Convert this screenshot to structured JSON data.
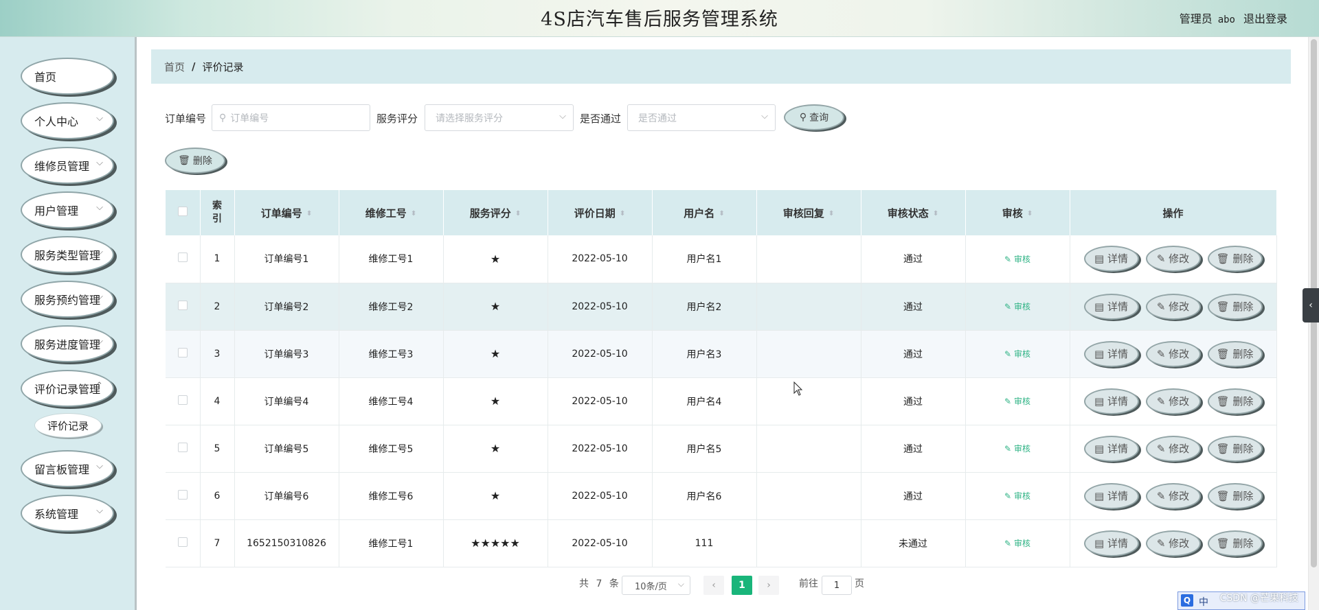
{
  "header": {
    "title": "4S店汽车售后服务管理系统",
    "user_role": "管理员",
    "user_name": "abo",
    "logout": "退出登录"
  },
  "sidebar": {
    "items": [
      {
        "label": "首页",
        "has_arrow": false
      },
      {
        "label": "个人中心",
        "has_arrow": true
      },
      {
        "label": "维修员管理",
        "has_arrow": true
      },
      {
        "label": "用户管理",
        "has_arrow": true
      },
      {
        "label": "服务类型管理",
        "has_arrow": true
      },
      {
        "label": "服务预约管理",
        "has_arrow": true
      },
      {
        "label": "服务进度管理",
        "has_arrow": true
      },
      {
        "label": "评价记录管理",
        "has_arrow": true
      },
      {
        "label": "留言板管理",
        "has_arrow": true
      },
      {
        "label": "系统管理",
        "has_arrow": true
      }
    ],
    "submenu": {
      "label": "评价记录"
    }
  },
  "breadcrumb": {
    "home": "首页",
    "separator": "/",
    "current": "评价记录"
  },
  "search": {
    "order_label": "订单编号",
    "order_placeholder": "订单编号",
    "score_label": "服务评分",
    "score_placeholder": "请选择服务评分",
    "pass_label": "是否通过",
    "pass_placeholder": "是否通过",
    "query_button": "查询",
    "delete_button": "删除"
  },
  "table": {
    "columns": [
      "索引",
      "订单编号",
      "维修工号",
      "服务评分",
      "评价日期",
      "用户名",
      "审核回复",
      "审核状态",
      "审核",
      "操作"
    ],
    "rows": [
      {
        "index": "1",
        "order": "订单编号1",
        "worker": "维修工号1",
        "score": "★",
        "date": "2022-05-10",
        "user": "用户名1",
        "reply": "",
        "status": "通过"
      },
      {
        "index": "2",
        "order": "订单编号2",
        "worker": "维修工号2",
        "score": "★",
        "date": "2022-05-10",
        "user": "用户名2",
        "reply": "",
        "status": "通过"
      },
      {
        "index": "3",
        "order": "订单编号3",
        "worker": "维修工号3",
        "score": "★",
        "date": "2022-05-10",
        "user": "用户名3",
        "reply": "",
        "status": "通过"
      },
      {
        "index": "4",
        "order": "订单编号4",
        "worker": "维修工号4",
        "score": "★",
        "date": "2022-05-10",
        "user": "用户名4",
        "reply": "",
        "status": "通过"
      },
      {
        "index": "5",
        "order": "订单编号5",
        "worker": "维修工号5",
        "score": "★",
        "date": "2022-05-10",
        "user": "用户名5",
        "reply": "",
        "status": "通过"
      },
      {
        "index": "6",
        "order": "订单编号6",
        "worker": "维修工号6",
        "score": "★",
        "date": "2022-05-10",
        "user": "用户名6",
        "reply": "",
        "status": "通过"
      },
      {
        "index": "7",
        "order": "1652150310826",
        "worker": "维修工号1",
        "score": "★★★★★",
        "date": "2022-05-10",
        "user": "111",
        "reply": "",
        "status": "未通过"
      }
    ],
    "audit_link": "审核",
    "actions": {
      "detail": "详情",
      "edit": "修改",
      "delete": "删除"
    }
  },
  "pagination": {
    "total_prefix": "共",
    "total": "7",
    "total_suffix": "条",
    "page_size": "10条/页",
    "current_page": "1",
    "goto_prefix": "前往",
    "goto_value": "1",
    "goto_suffix": "页"
  },
  "watermark": "CSDN @芒果科技",
  "ime": {
    "icon": "Q",
    "text": "中"
  },
  "colors": {
    "accent": "#19b57a",
    "panel": "#d7ebee",
    "audit": "#2fb385"
  }
}
